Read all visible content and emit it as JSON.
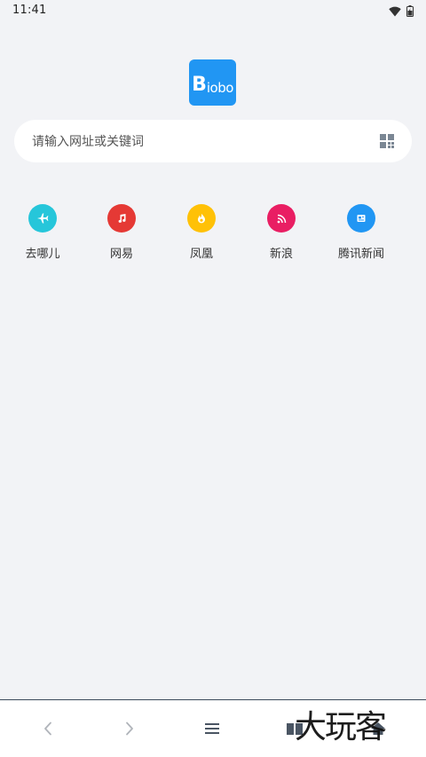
{
  "status_bar": {
    "time": "11:41",
    "icons": [
      "wifi-icon",
      "battery-icon"
    ]
  },
  "logo": {
    "big_letter": "B",
    "small_text": "iobo",
    "color": "#2196f3"
  },
  "search": {
    "placeholder": "请输入网址或关键词",
    "right_icon": "qr-grid-icon"
  },
  "quick_links": [
    {
      "label": "去哪儿",
      "icon": "airplane-icon",
      "color": "#26c6da"
    },
    {
      "label": "网易",
      "icon": "music-note-icon",
      "color": "#e53935"
    },
    {
      "label": "凤凰",
      "icon": "fire-icon",
      "color": "#ffc107"
    },
    {
      "label": "新浪",
      "icon": "rss-icon",
      "color": "#e91e63"
    },
    {
      "label": "腾讯新闻",
      "icon": "news-icon",
      "color": "#2196f3"
    }
  ],
  "bottom_nav": {
    "items": [
      "back-icon",
      "forward-icon",
      "menu-icon",
      "book-icon",
      "home-icon"
    ]
  },
  "watermark": {
    "text": "大玩客"
  }
}
